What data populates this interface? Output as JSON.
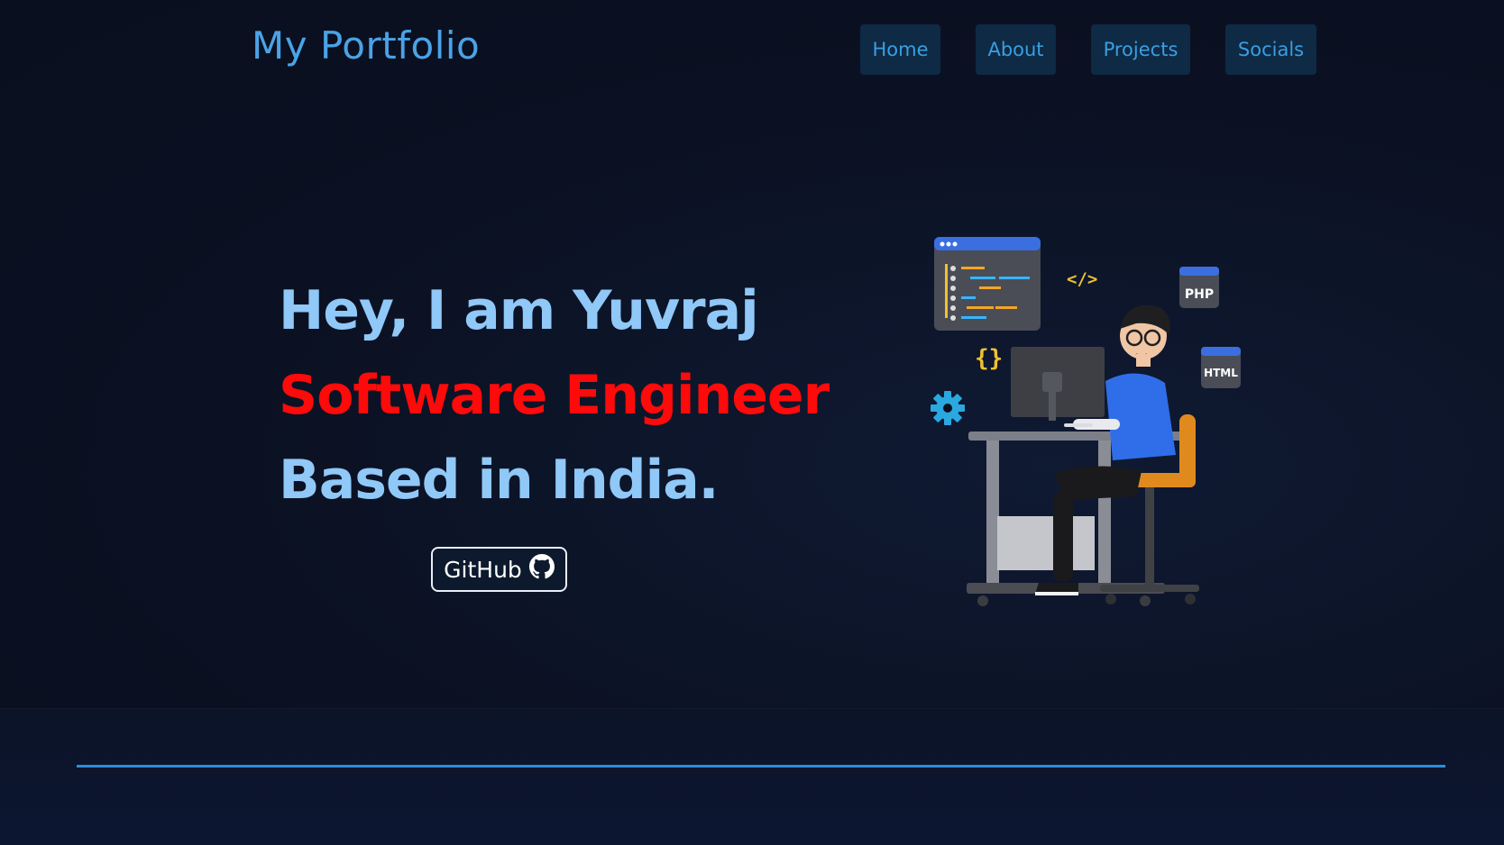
{
  "header": {
    "logo": "My Portfolio",
    "nav": [
      {
        "label": "Home"
      },
      {
        "label": "About"
      },
      {
        "label": "Projects"
      },
      {
        "label": "Socials"
      }
    ]
  },
  "hero": {
    "line1": "Hey, I am Yuvraj",
    "line2": "Software Engineer",
    "line3": "Based in India.",
    "github_label": "GitHub",
    "github_icon": "github-icon"
  },
  "illustration": {
    "tags": {
      "code": "</>",
      "braces": "{}",
      "php": "PHP",
      "html": "HTML"
    }
  },
  "colors": {
    "background": "#0b1020",
    "logo": "#4aa3e6",
    "nav_bg": "#0e2a45",
    "nav_text": "#3b9ee0",
    "hero_light": "#90c8f8",
    "hero_red": "#ff0a0a",
    "divider": "#2b8fdb"
  }
}
